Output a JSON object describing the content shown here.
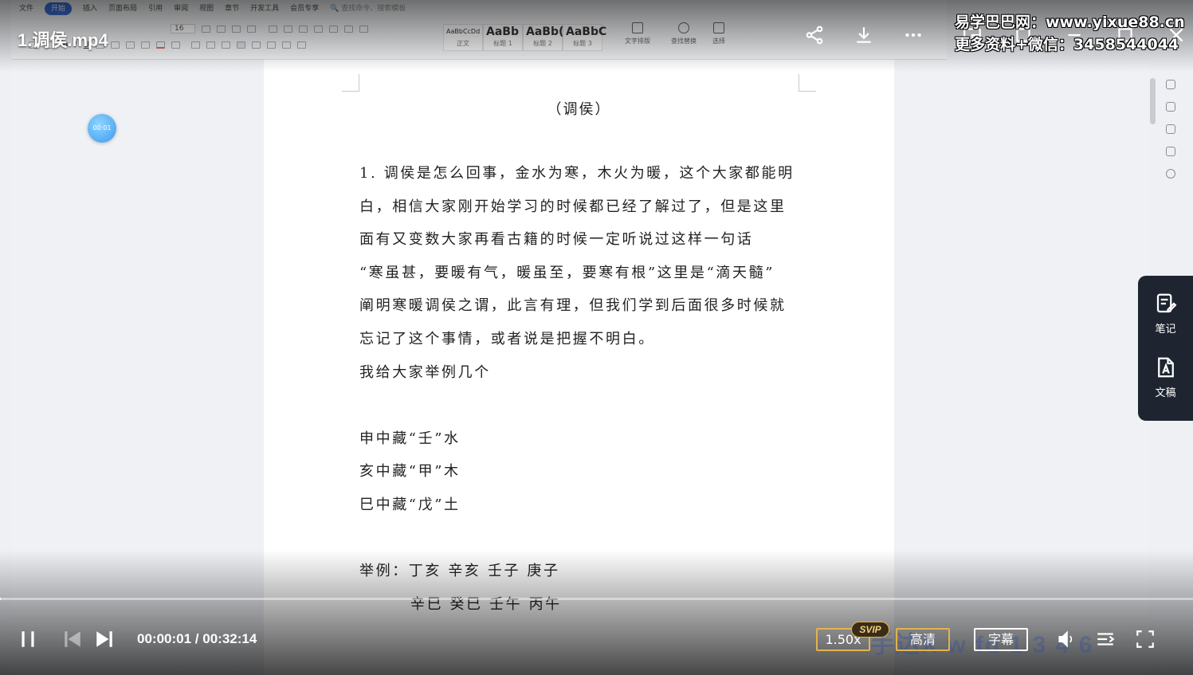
{
  "video": {
    "title": "1.调侯.mp4",
    "current_time": "00:00:01",
    "duration": "00:32:14",
    "progress_fraction": 0.0005,
    "bookmark_time": "00:01",
    "speed_label": "1.50x",
    "speed_badge": "SVIP",
    "quality_label": "高清",
    "subtitle_label": "字幕",
    "ghost_overlay_text": "手达X w fd 1 3 4 6"
  },
  "watermark": {
    "line1": "易学巴巴网：www.yixue88.cn",
    "line2": "更多资料+微信：3458544044"
  },
  "side_panel": {
    "notes_label": "笔记",
    "draft_label": "文稿"
  },
  "word_app": {
    "menu": [
      "文件",
      "开始",
      "插入",
      "页面布局",
      "引用",
      "审阅",
      "视图",
      "章节",
      "开发工具",
      "会员专享"
    ],
    "active_menu": "开始",
    "search_placeholder": "查找命令、搜索模板",
    "font_size": "16",
    "styles": [
      {
        "sample": "AaBbCcDd",
        "caption": "正文"
      },
      {
        "sample": "AaBb",
        "caption": "标题 1"
      },
      {
        "sample": "AaBb(",
        "caption": "标题 2"
      },
      {
        "sample": "AaBbC",
        "caption": "标题 3"
      }
    ],
    "tools": [
      {
        "caption": "文字排版",
        "icon": "text-layout-icon"
      },
      {
        "caption": "查找替换",
        "icon": "find-replace-icon"
      },
      {
        "caption": "选择",
        "icon": "select-cursor-icon"
      }
    ]
  },
  "document": {
    "title": "（调侯）",
    "lines": [
      "1. 调侯是怎么回事，金水为寒，木火为暖，这个大家都能明",
      "白，相信大家刚开始学习的时候都已经了解过了，但是这里",
      "面有又变数大家再看古籍的时候一定听说过这样一句话",
      "“寒虽甚，要暖有气，暖虽至，要寒有根”这里是“滴天髓”",
      "阐明寒暖调侯之谓，此言有理，但我们学到后面很多时候就",
      "忘记了这个事情，或者说是把握不明白。",
      "我给大家举例几个",
      "",
      "申中藏“壬”水",
      "亥中藏“甲”木",
      "巳中藏“戊”土",
      "",
      "举例：丁亥  辛亥  壬子  庚子",
      "辛巳  癸巳  壬午  丙午"
    ]
  }
}
